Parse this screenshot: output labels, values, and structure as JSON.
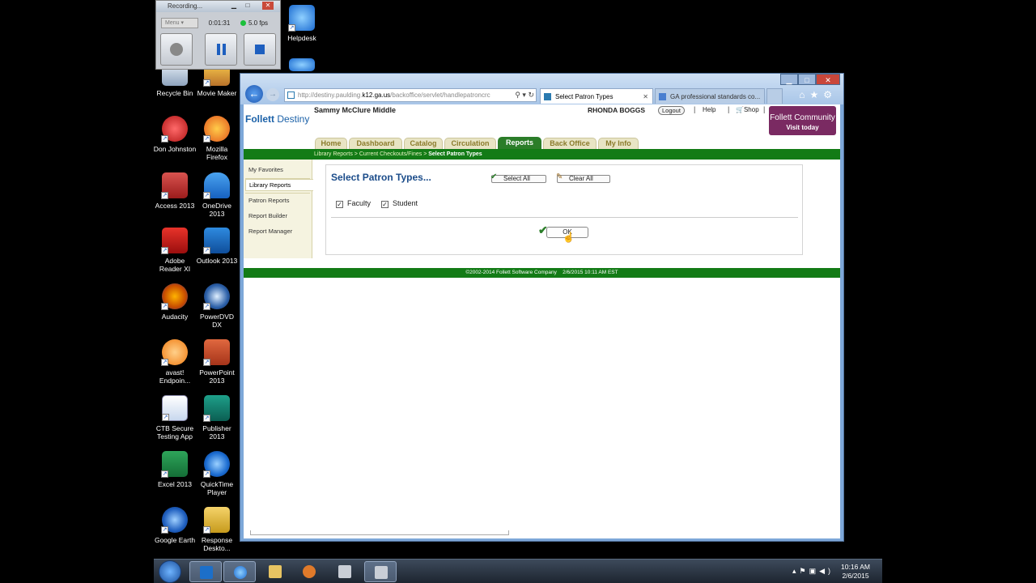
{
  "recorder": {
    "title": "Recording...",
    "menu_label": "Menu",
    "elapsed": "0:01:31",
    "fps": "5.0 fps"
  },
  "desktop_icons": [
    {
      "label": "Helpdesk"
    },
    {
      "label": "Recycle Bin"
    },
    {
      "label": "Movie Maker"
    },
    {
      "label": "Don Johnston"
    },
    {
      "label": "Mozilla Firefox"
    },
    {
      "label": "Access 2013"
    },
    {
      "label": "OneDrive 2013"
    },
    {
      "label": "Adobe Reader XI"
    },
    {
      "label": "Outlook 2013"
    },
    {
      "label": "Audacity"
    },
    {
      "label": "PowerDVD DX"
    },
    {
      "label": "avast! Endpoin..."
    },
    {
      "label": "PowerPoint 2013"
    },
    {
      "label": "CTB Secure Testing App"
    },
    {
      "label": "Publisher 2013"
    },
    {
      "label": "Excel 2013"
    },
    {
      "label": "QuickTime Player"
    },
    {
      "label": "Google Earth"
    },
    {
      "label": "Response Deskto..."
    }
  ],
  "browser": {
    "address": {
      "prefix": "http://destiny.paulding.",
      "host": "k12.ga.us",
      "path": "/backoffice/servlet/handlepatroncrc"
    },
    "tabs": [
      {
        "label": "Select Patron Types",
        "active": true
      },
      {
        "label": "GA professional standards co...",
        "active": false
      }
    ]
  },
  "header": {
    "logo_main": "Follett",
    "logo_sub": "Destiny",
    "school": "Sammy McClure Middle",
    "user": "RHONDA BOGGS",
    "logout": "Logout",
    "help": "Help",
    "shop": "Shop",
    "community_line1": "Follett Community",
    "community_line2": "Visit today"
  },
  "nav": {
    "tabs": [
      {
        "label": "Home"
      },
      {
        "label": "Dashboard"
      },
      {
        "label": "Catalog"
      },
      {
        "label": "Circulation"
      },
      {
        "label": "Reports",
        "active": true
      },
      {
        "label": "Back Office"
      },
      {
        "label": "My Info"
      }
    ],
    "breadcrumb": "Library Reports > Current Checkouts/Fines > ",
    "breadcrumb_current": "Select Patron Types"
  },
  "sidebar": {
    "items": [
      {
        "label": "My Favorites"
      },
      {
        "label": "Library Reports",
        "active": true
      },
      {
        "label": "Patron Reports"
      },
      {
        "label": "Report Builder"
      },
      {
        "label": "Report Manager"
      }
    ]
  },
  "content": {
    "title": "Select Patron Types...",
    "select_all": "Select All",
    "clear_all": "Clear All",
    "checkboxes": [
      {
        "label": "Faculty",
        "checked": true
      },
      {
        "label": "Student",
        "checked": true
      }
    ],
    "ok": "OK"
  },
  "footer": {
    "copyright": "©2002-2014  Follett Software Company",
    "timestamp": "2/6/2015 10:11 AM EST"
  },
  "taskbar": {
    "time": "10:16 AM",
    "date": "2/6/2015"
  },
  "colors": {
    "green": "#137b16",
    "nav_active": "#2b7d29",
    "title_blue": "#1b4c8a",
    "community": "#7a2a62"
  }
}
